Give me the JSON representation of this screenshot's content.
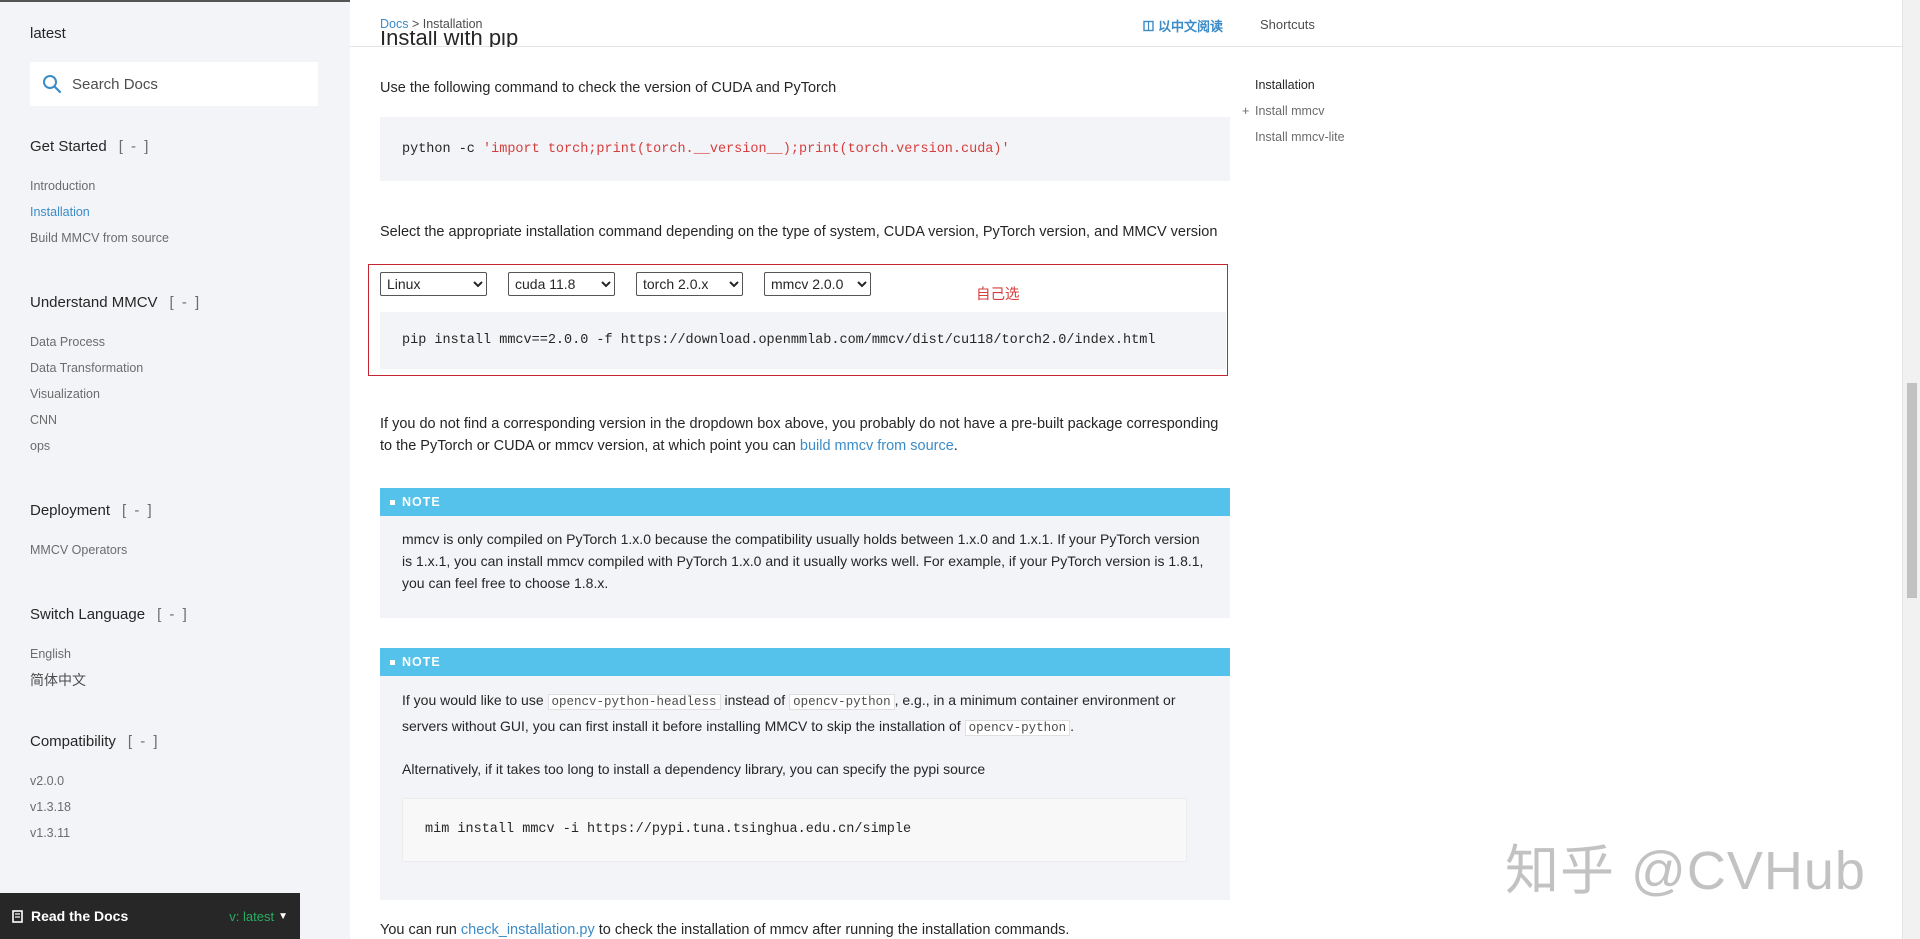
{
  "sidebar": {
    "version_label": "latest",
    "search_placeholder": "Search Docs",
    "sections": [
      {
        "heading": "Get Started",
        "toggle": "[ - ]",
        "items": [
          "Introduction",
          "Installation",
          "Build MMCV from source"
        ]
      },
      {
        "heading": "Understand MMCV",
        "toggle": "[ - ]",
        "items": [
          "Data Process",
          "Data Transformation",
          "Visualization",
          "CNN",
          "ops"
        ]
      },
      {
        "heading": "Deployment",
        "toggle": "[ - ]",
        "items": [
          "MMCV Operators"
        ]
      },
      {
        "heading": "Switch Language",
        "toggle": "[ - ]",
        "items": [
          "English",
          "简体中文"
        ]
      },
      {
        "heading": "Compatibility",
        "toggle": "[ - ]",
        "items": [
          "v2.0.0",
          "v1.3.18",
          "v1.3.11"
        ]
      }
    ],
    "active_item": "Installation",
    "rtd_label": "Read the Docs",
    "rtd_version": "v: latest"
  },
  "header": {
    "breadcrumb_root": "Docs",
    "breadcrumb_sep": " > ",
    "breadcrumb_current": "Installation",
    "zh_read": "以中文阅读",
    "shortcuts": "Shortcuts"
  },
  "main": {
    "heading_partial": "Install with pip",
    "check_text": "Use the following command to check the version of CUDA and PyTorch",
    "check_cmd_prefix": "python -c ",
    "check_cmd_str": "'import torch;print(torch.__version__);print(torch.version.cuda)'",
    "select_text": "Select the appropriate installation command depending on the type of system, CUDA version, PyTorch version, and MMCV version",
    "selects": {
      "system": "Linux",
      "cuda": "cuda 11.8",
      "torch": "torch 2.0.x",
      "mmcv": "mmcv 2.0.0"
    },
    "annotation": "自己选",
    "pip_cmd": "pip install mmcv==2.0.0 -f https://download.openmmlab.com/mmcv/dist/cu118/torch2.0/index.html",
    "notfound_text": "If you do not find a corresponding version in the dropdown box above, you probably do not have a pre-built package corresponding to the PyTorch or CUDA or mmcv version, at which point you can ",
    "notfound_link": "build mmcv from source",
    "notfound_end": ".",
    "note1_title": "NOTE",
    "note1_text": "mmcv is only compiled on PyTorch 1.x.0 because the compatibility usually holds between 1.x.0 and 1.x.1. If your PyTorch version is 1.x.1, you can install mmcv compiled with PyTorch 1.x.0 and it usually works well. For example, if your PyTorch version is 1.8.1, you can feel free to choose 1.8.x.",
    "note2_title": "NOTE",
    "note2_p1_a": "If you would like to use ",
    "note2_code1": "opencv-python-headless",
    "note2_p1_b": " instead of ",
    "note2_code2": "opencv-python",
    "note2_p1_c": ", e.g., in a minimum container environment or servers without GUI, you can first install it before installing MMCV to skip the installation of ",
    "note2_code3": "opencv-python",
    "note2_p1_d": ".",
    "note2_p2": "Alternatively, if it takes too long to install a dependency library, you can specify the pypi source",
    "mim_cmd": "mim install mmcv -i https://pypi.tuna.tsinghua.edu.cn/simple",
    "run_text_a": "You can run ",
    "run_link": "check_installation.py",
    "run_text_b": " to check the installation of mmcv after running the installation commands."
  },
  "toc": {
    "title": "Installation",
    "items": [
      {
        "plus": "+",
        "label": "Install mmcv"
      },
      {
        "plus": "",
        "label": "Install mmcv-lite"
      }
    ]
  },
  "watermark": "知乎 @CVHub",
  "colors": {
    "sidebar_bg": "#f3f4f7",
    "link": "#3a8bc8",
    "note_header": "#54c2ea",
    "annotation_red": "#d63e3e",
    "rtd_bar": "#272727",
    "rtd_version": "#27ae60"
  }
}
